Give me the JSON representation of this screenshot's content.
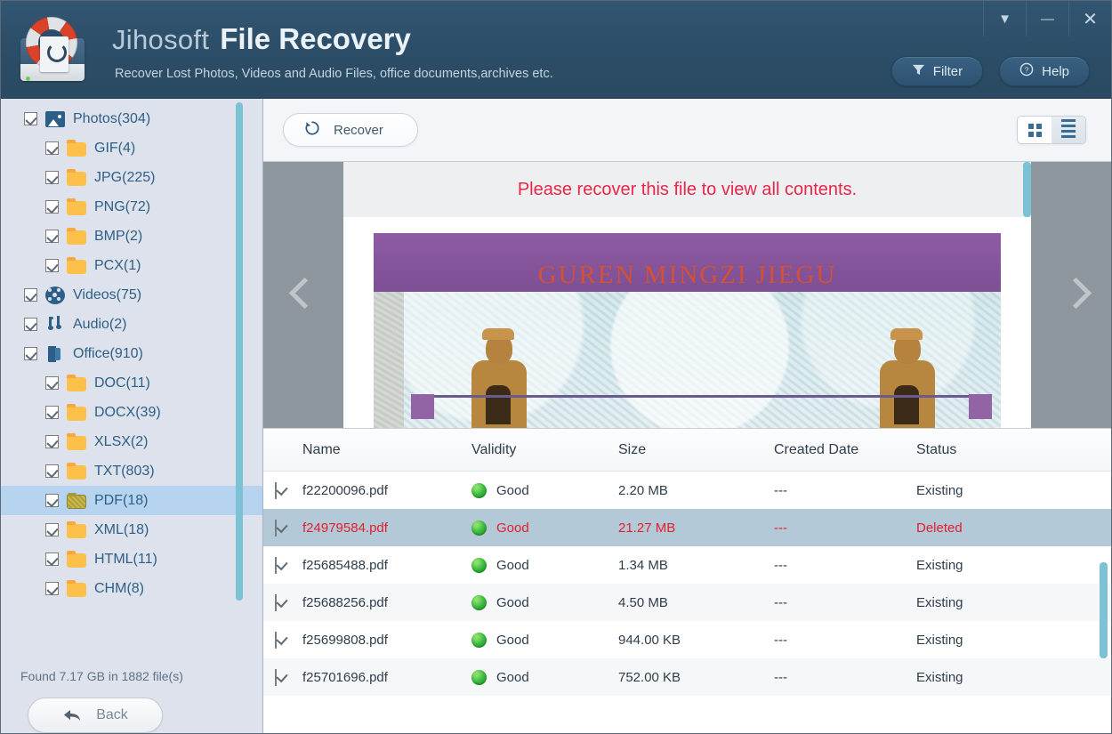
{
  "window": {
    "controls": [
      {
        "name": "dropdown",
        "glyph": "▼"
      },
      {
        "name": "minimize",
        "glyph": "—"
      },
      {
        "name": "close",
        "glyph": "✕"
      }
    ]
  },
  "header": {
    "brand_first": "Jihosoft",
    "brand_second": "File Recovery",
    "subtitle": "Recover Lost Photos, Videos and Audio Files, office documents,archives etc.",
    "filter_label": "Filter",
    "help_label": "Help",
    "background_color": "#2d4e68"
  },
  "sidebar": {
    "items": [
      {
        "label": "Photos(304)",
        "icon": "photo-icon",
        "level": 0,
        "checked": true,
        "selected": false
      },
      {
        "label": "GIF(4)",
        "icon": "folder-icon",
        "level": 1,
        "checked": true,
        "selected": false
      },
      {
        "label": "JPG(225)",
        "icon": "folder-icon",
        "level": 1,
        "checked": true,
        "selected": false
      },
      {
        "label": "PNG(72)",
        "icon": "folder-icon",
        "level": 1,
        "checked": true,
        "selected": false
      },
      {
        "label": "BMP(2)",
        "icon": "folder-icon",
        "level": 1,
        "checked": true,
        "selected": false
      },
      {
        "label": "PCX(1)",
        "icon": "folder-icon",
        "level": 1,
        "checked": true,
        "selected": false
      },
      {
        "label": "Videos(75)",
        "icon": "film-reel-icon",
        "level": 0,
        "checked": true,
        "selected": false
      },
      {
        "label": "Audio(2)",
        "icon": "music-note-icon",
        "level": 0,
        "checked": true,
        "selected": false
      },
      {
        "label": "Office(910)",
        "icon": "office-icon",
        "level": 0,
        "checked": true,
        "selected": false
      },
      {
        "label": "DOC(11)",
        "icon": "folder-icon",
        "level": 1,
        "checked": true,
        "selected": false
      },
      {
        "label": "DOCX(39)",
        "icon": "folder-icon",
        "level": 1,
        "checked": true,
        "selected": false
      },
      {
        "label": "XLSX(2)",
        "icon": "folder-icon",
        "level": 1,
        "checked": true,
        "selected": false
      },
      {
        "label": "TXT(803)",
        "icon": "folder-icon",
        "level": 1,
        "checked": true,
        "selected": false
      },
      {
        "label": "PDF(18)",
        "icon": "folder-open-icon",
        "level": 1,
        "checked": true,
        "selected": true
      },
      {
        "label": "XML(18)",
        "icon": "folder-icon",
        "level": 1,
        "checked": true,
        "selected": false
      },
      {
        "label": "HTML(11)",
        "icon": "folder-icon",
        "level": 1,
        "checked": true,
        "selected": false
      },
      {
        "label": "CHM(8)",
        "icon": "folder-icon",
        "level": 1,
        "checked": true,
        "selected": false
      }
    ],
    "found_text": "Found 7.17 GB in 1882 file(s)",
    "back_label": "Back",
    "selection_color": "#b6d4ef",
    "scrollbar_color": "#7cc2d4"
  },
  "toolbar": {
    "recover_label": "Recover",
    "view_grid_label": "grid-view",
    "view_list_label": "list-view",
    "active_view": "list"
  },
  "preview": {
    "message": "Please recover this file to view all contents.",
    "message_color": "#e8264a",
    "cover_title": "GUREN MINGZI JIEGU",
    "prev_label": "previous",
    "next_label": "next",
    "panel_color": "#8d979d"
  },
  "table": {
    "columns": [
      "Name",
      "Validity",
      "Size",
      "Created Date",
      "Status"
    ],
    "rows": [
      {
        "checked": true,
        "name": "f22200096.pdf",
        "validity": "Good",
        "size": "2.20 MB",
        "created": "---",
        "status": "Existing",
        "selected": false
      },
      {
        "checked": true,
        "name": "f24979584.pdf",
        "validity": "Good",
        "size": "21.27 MB",
        "created": "---",
        "status": "Deleted",
        "selected": true
      },
      {
        "checked": true,
        "name": "f25685488.pdf",
        "validity": "Good",
        "size": "1.34 MB",
        "created": "---",
        "status": "Existing",
        "selected": false
      },
      {
        "checked": true,
        "name": "f25688256.pdf",
        "validity": "Good",
        "size": "4.50 MB",
        "created": "---",
        "status": "Existing",
        "selected": false
      },
      {
        "checked": true,
        "name": "f25699808.pdf",
        "validity": "Good",
        "size": "944.00 KB",
        "created": "---",
        "status": "Existing",
        "selected": false
      },
      {
        "checked": true,
        "name": "f25701696.pdf",
        "validity": "Good",
        "size": "752.00 KB",
        "created": "---",
        "status": "Existing",
        "selected": false
      }
    ],
    "selected_row_color": "#b4c9d7",
    "deleted_text_color": "#e0202e",
    "good_dot_color": "#34b53a"
  }
}
